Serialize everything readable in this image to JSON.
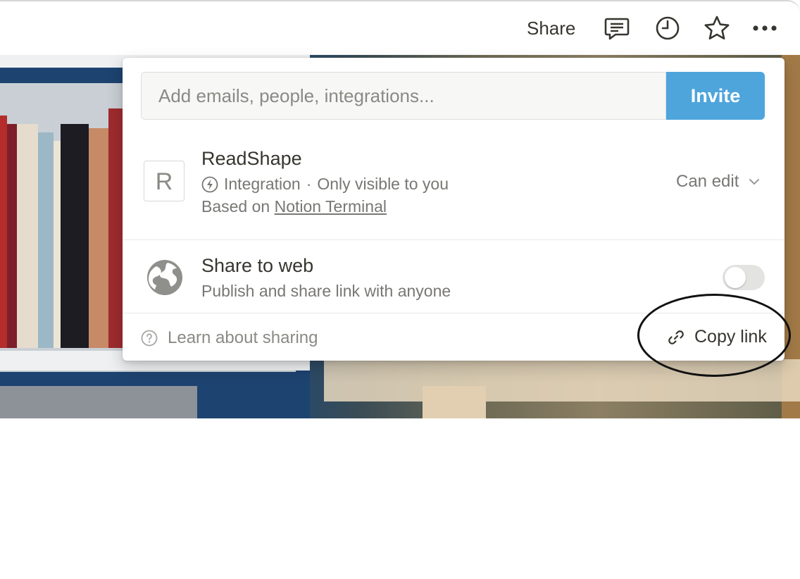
{
  "topbar": {
    "share_label": "Share",
    "icons": [
      "comment-icon",
      "history-icon",
      "star-icon",
      "more-icon"
    ]
  },
  "invite": {
    "placeholder": "Add emails, people, integrations...",
    "button_label": "Invite",
    "button_color": "#4ea5dc"
  },
  "member": {
    "avatar_letter": "R",
    "name": "ReadShape",
    "type": "Integration",
    "separator": "·",
    "visibility": "Only visible to you",
    "based_prefix": "Based on",
    "based_link": "Notion Terminal",
    "permission": "Can edit"
  },
  "share_web": {
    "title": "Share to web",
    "subtitle": "Publish and share link with anyone",
    "enabled": false
  },
  "footer": {
    "help_label": "Learn about sharing",
    "copy_label": "Copy link"
  },
  "annotation": {
    "type": "circle",
    "target": "copy-link-button"
  }
}
